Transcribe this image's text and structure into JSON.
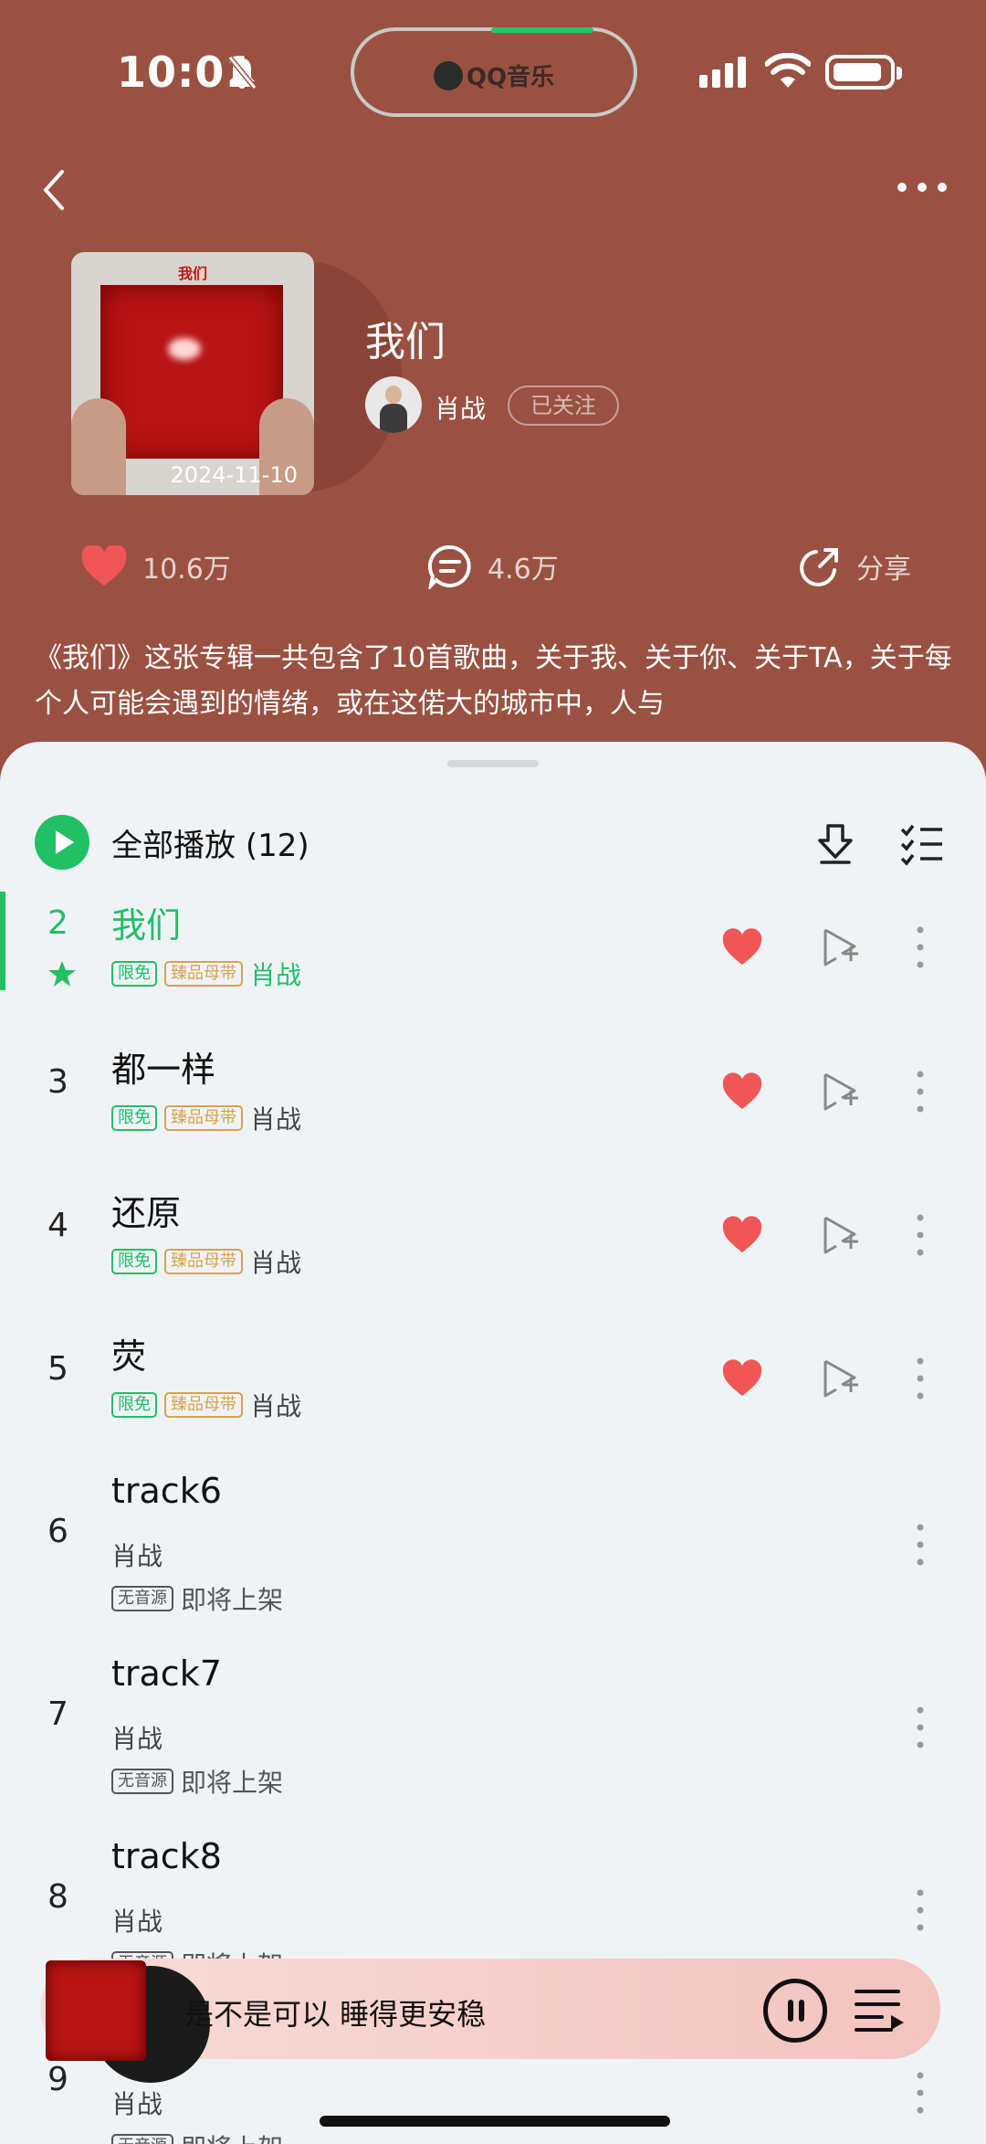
{
  "status_bar": {
    "time": "10:01",
    "island_label": "QQ音乐"
  },
  "header": {
    "cover_title": "我们",
    "cover_date": "2024-11-10",
    "album_title": "我们",
    "artist": "肖战",
    "follow_label": "已关注",
    "likes": "10.6万",
    "comments": "4.6万",
    "share_label": "分享",
    "description": "《我们》这张专辑一共包含了10首歌曲，关于我、关于你、关于TA，关于每个人可能会遇到的情绪，或在这偌大的城市中，人与"
  },
  "toolbar": {
    "play_all_label": "全部播放",
    "count": "(12)"
  },
  "tracks": [
    {
      "no": "2",
      "title": "我们",
      "tag_free": "限免",
      "tag_quality": "臻品母带",
      "artist": "肖战"
    },
    {
      "no": "3",
      "title": "都一样",
      "tag_free": "限免",
      "tag_quality": "臻品母带",
      "artist": "肖战"
    },
    {
      "no": "4",
      "title": "还原",
      "tag_free": "限免",
      "tag_quality": "臻品母带",
      "artist": "肖战"
    },
    {
      "no": "5",
      "title": "荧",
      "tag_free": "限免",
      "tag_quality": "臻品母带",
      "artist": "肖战"
    }
  ],
  "upcoming": [
    {
      "no": "6",
      "title": "track6",
      "artist": "肖战",
      "tag": "无音源",
      "status": "即将上架"
    },
    {
      "no": "7",
      "title": "track7",
      "artist": "肖战",
      "tag": "无音源",
      "status": "即将上架"
    },
    {
      "no": "8",
      "title": "track8",
      "artist": "肖战",
      "tag": "无音源",
      "status": "即将上架"
    },
    {
      "no": "9",
      "artist": "肖战",
      "tag": "无音源",
      "status": "即将上架"
    }
  ],
  "player": {
    "now_playing": "是不是可以 睡得更安稳"
  },
  "colors": {
    "header_bg": "#9b5142",
    "accent_green": "#21c065",
    "heart_red": "#f05656",
    "tag_gold": "#d8a24d"
  }
}
